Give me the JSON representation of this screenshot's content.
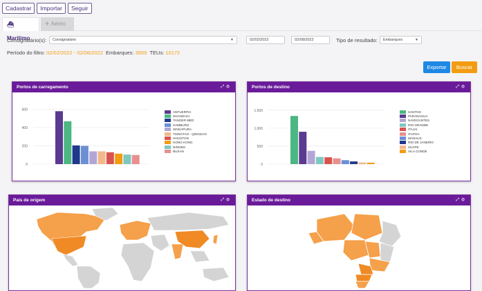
{
  "toolbar": {
    "cadastrar": "Cadastrar",
    "importar": "Importar",
    "seguir": "Seguir"
  },
  "tabs": {
    "maritimo": "Marítimo",
    "aereo": "Aéreo"
  },
  "filters": {
    "consignatario_label": "Consignatário(s):",
    "consignatario_value": "Consignatário",
    "date_from": "02/02/2022",
    "date_to": "02/08/2022",
    "tipo_label": "Tipo de resultado:",
    "tipo_value": "Embarques"
  },
  "summary": {
    "periodo_label": "Período do filtro:",
    "periodo_value": "02/02/2022 - 02/08/2022",
    "embarques_label": "Embarques:",
    "embarques_value": "3569",
    "teus_label": "TEUs:",
    "teus_value": "10172"
  },
  "actions": {
    "exportar": "Exportar",
    "buscar": "Buscar"
  },
  "colors": {
    "accent": "#6a1b9a",
    "exportar": "#1e88e5",
    "buscar": "#f39c12",
    "map_highlight": "#f5a04a",
    "map_strong": "#f08a24",
    "map_base": "#d4d4d4"
  },
  "panels": {
    "carregamento_title": "Portos de carregamento",
    "destino_title": "Portos de destino",
    "origem_title": "País de origem",
    "estado_title": "Estado de destino"
  },
  "chart_data": [
    {
      "type": "bar",
      "title": "Portos de carregamento",
      "categories": [
        "ANTUERPIA",
        "SHANGHAI",
        "TANGER MED",
        "HAMBURG",
        "SINGAPURA",
        "TSINGTAO - QINGDAO",
        "HOUSTON",
        "HONG KONG",
        "NINGBO",
        "BUSAN"
      ],
      "values": [
        580,
        470,
        205,
        200,
        140,
        140,
        130,
        115,
        105,
        100
      ],
      "colors": [
        "#5b3a91",
        "#4cb782",
        "#1f3a8c",
        "#6a8fd4",
        "#b3a6d6",
        "#f2b98a",
        "#d9534f",
        "#f39c12",
        "#7ec8c0",
        "#e88f8f"
      ],
      "yticks": [
        "0",
        "200",
        "400",
        "600"
      ],
      "ylim": [
        0,
        650
      ]
    },
    {
      "type": "bar",
      "title": "Portos de destino",
      "categories": [
        "SANTOS",
        "PARANAGUA",
        "NAVEGANTES",
        "RIO GRANDE",
        "ITAJAI",
        "ITAPOA",
        "MANAUS",
        "RIO DE JANEIRO",
        "SUAPE",
        "VILA CONDE"
      ],
      "values": [
        1340,
        900,
        370,
        200,
        190,
        160,
        110,
        75,
        45,
        40
      ],
      "colors": [
        "#4cb782",
        "#5b3a91",
        "#b3a6d6",
        "#7ec8c0",
        "#d9534f",
        "#e88f8f",
        "#6a8fd4",
        "#1f3a8c",
        "#f2b98a",
        "#f39c12"
      ],
      "yticks": [
        "0",
        "500",
        "1,000",
        "1,500"
      ],
      "ylim": [
        0,
        1650
      ]
    }
  ]
}
